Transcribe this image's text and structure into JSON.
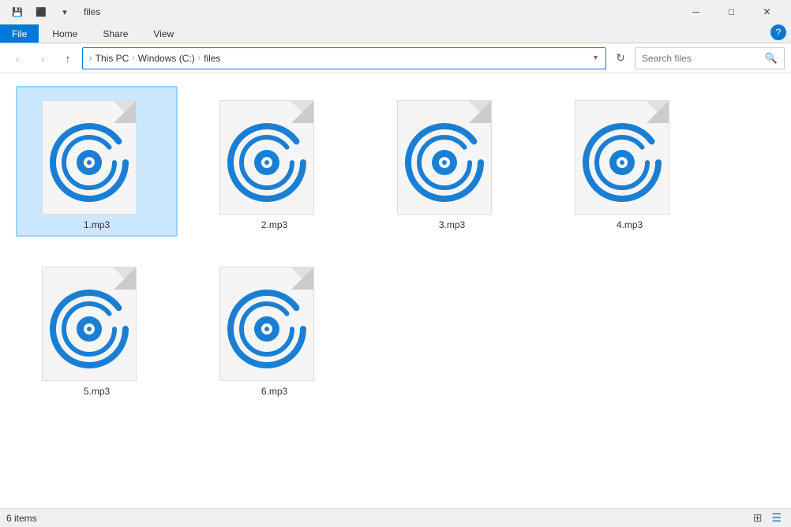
{
  "window": {
    "title": "files",
    "icon": "folder-icon"
  },
  "title_bar": {
    "qat_buttons": [
      "save-icon",
      "undo-icon",
      "redo-icon"
    ],
    "controls": [
      "minimize",
      "maximize",
      "close"
    ],
    "minimize_label": "─",
    "maximize_label": "□",
    "close_label": "✕",
    "dropdown_label": "▾"
  },
  "ribbon": {
    "tabs": [
      {
        "id": "file",
        "label": "File",
        "active": true
      },
      {
        "id": "home",
        "label": "Home",
        "active": false
      },
      {
        "id": "share",
        "label": "Share",
        "active": false
      },
      {
        "id": "view",
        "label": "View",
        "active": false
      }
    ],
    "groups": []
  },
  "nav_bar": {
    "back_tooltip": "Back",
    "forward_tooltip": "Forward",
    "up_tooltip": "Up",
    "breadcrumbs": [
      "This PC",
      "Windows (C:)",
      "files"
    ],
    "refresh_tooltip": "Refresh",
    "search_placeholder": "Search files"
  },
  "files": [
    {
      "id": "1",
      "name": "1.mp3",
      "selected": true
    },
    {
      "id": "2",
      "name": "2.mp3",
      "selected": false
    },
    {
      "id": "3",
      "name": "3.mp3",
      "selected": false
    },
    {
      "id": "4",
      "name": "4.mp3",
      "selected": false
    },
    {
      "id": "5",
      "name": "5.mp3",
      "selected": false
    },
    {
      "id": "6",
      "name": "6.mp3",
      "selected": false
    }
  ],
  "status_bar": {
    "item_count": "6 items"
  },
  "colors": {
    "accent": "#0078d7",
    "cd_blue": "#1a7fd4",
    "selected_bg": "#cce8ff",
    "selected_border": "#99d1ff"
  }
}
